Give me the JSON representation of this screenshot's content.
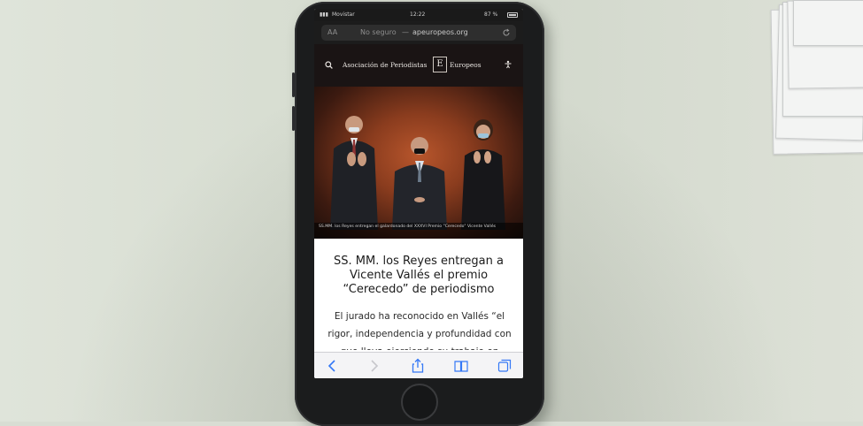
{
  "status_bar": {
    "carrier": "Movistar",
    "time": "12:22",
    "battery": "87 %"
  },
  "browser": {
    "text_size_label": "AA",
    "security_label": "No seguro",
    "separator": "—",
    "domain": "apeuropeos.org"
  },
  "site": {
    "name_left": "Asociación de Periodistas",
    "logo_letter": "E",
    "name_right": "Europeos"
  },
  "photo": {
    "caption": "SS.MM. los Reyes entregan el galardonado del XXXVI Premio \"Cerecedo\" Vicente Vallés"
  },
  "article": {
    "title_line1": "SS. MM. los Reyes entregan a",
    "title_line2": "Vicente Vallés el premio",
    "title_line3": "“Cerecedo” de periodismo",
    "lead": "El jurado ha reconocido en Vallés “el rigor, independencia y profundidad con que lleva ejerciendo su trabajo en"
  },
  "colors": {
    "desk": "#d8ddd3",
    "phone_body": "#1b1c1d",
    "ios_blue": "#3478f6",
    "hero_orange": "#b8562c"
  },
  "icons": {
    "search": "search-icon",
    "accessibility": "accessibility-icon",
    "reload": "reload-icon",
    "back": "chevron-left-icon",
    "forward": "chevron-right-icon",
    "share": "share-icon",
    "bookmarks": "book-icon",
    "tabs": "tabs-icon"
  }
}
